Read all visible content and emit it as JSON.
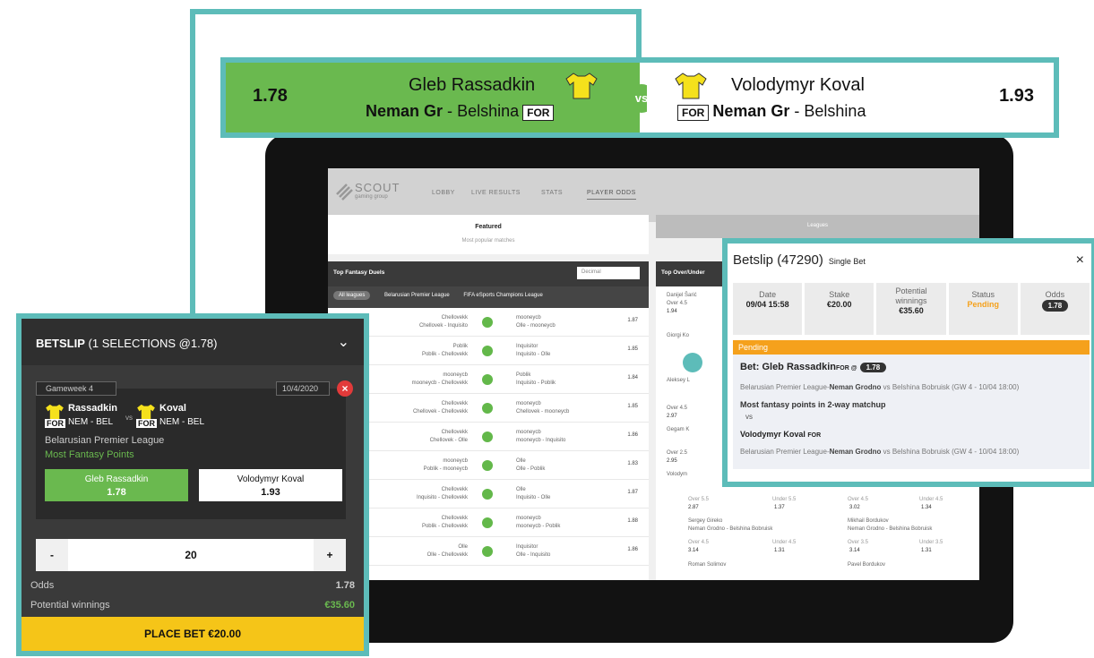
{
  "colors": {
    "accent_teal": "#5dbcb9",
    "green": "#6ab94f",
    "yellow": "#f5c518",
    "pending": "#f5a11c"
  },
  "duel": {
    "left_odds": "1.78",
    "left_player": "Gleb Rassadkin",
    "left_team": "Neman Gr",
    "left_sep": "-",
    "left_opp": "Belshina",
    "left_pos": "FOR",
    "vs": "vs",
    "right_player": "Volodymyr Koval",
    "right_team": "Neman Gr",
    "right_sep": "-",
    "right_opp": "Belshina",
    "right_pos": "FOR",
    "right_odds": "1.93"
  },
  "screen": {
    "logo": "SCOUT",
    "logo_sub": "gaming group",
    "nav": [
      "LOBBY",
      "LIVE RESULTS",
      "STATS",
      "PLAYER ODDS"
    ],
    "tab_featured": "Featured",
    "tab_featured_sub": "Most popular matches",
    "tab_leagues": "Leagues",
    "duels_title": "Top Fantasy Duels",
    "duels_select": "Decimal",
    "leagues": [
      "All leagues",
      "Belarusian Premier League",
      "FIFA eSports Champions League"
    ],
    "ou_title": "Top Over/Under",
    "rows": [
      {
        "l1": "Chellovekk",
        "l2": "Chellovek - Inquisito",
        "r1": "mooneycb",
        "r2": "Olle - mooneycb",
        "odds": "1.87"
      },
      {
        "l1": "Poblik",
        "l2": "Poblik - Chellovekk",
        "r1": "Inquisitor",
        "r2": "Inquisito - Olle",
        "odds": "1.85"
      },
      {
        "l1": "mooneycb",
        "l2": "mooneycb - Chellovekk",
        "r1": "Poblik",
        "r2": "Inquisito - Poblik",
        "odds": "1.84"
      },
      {
        "l1": "Chellovekk",
        "l2": "Chellovek - Chellovekk",
        "r1": "mooneycb",
        "r2": "Chellovek - mooneycb",
        "odds": "1.85"
      },
      {
        "l1": "Chellovekk",
        "l2": "Chellovek - Olle",
        "r1": "mooneycb",
        "r2": "mooneycb - Inquisito",
        "odds": "1.86"
      },
      {
        "l1": "mooneycb",
        "l2": "Poblik - mooneycb",
        "r1": "Olle",
        "r2": "Olle - Poblik",
        "odds": "1.83"
      },
      {
        "l1": "Chellovekk",
        "l2": "Inquisito - Chellovekk",
        "r1": "Olle",
        "r2": "Inquisito - Olle",
        "odds": "1.87"
      },
      {
        "l1": "Chellovekk",
        "l2": "Poblik - Chellovekk",
        "r1": "mooneycb",
        "r2": "mooneycb - Poblik",
        "odds": "1.88"
      },
      {
        "l1": "Olle",
        "l2": "Olle - Chellovekk",
        "r1": "Inquisitor",
        "r2": "Olle - Inquisito",
        "odds": "1.86"
      }
    ],
    "ou_rows": [
      {
        "name": "Danijel Šarić",
        "odds": "1.94",
        "label": "Over 4.5"
      },
      {
        "name": "Giorgi Ko",
        "odds": "",
        "label": ""
      },
      {
        "name": "Aleksey L",
        "odds": "",
        "label": ""
      },
      {
        "name": "Gegam K",
        "odds": "2.97",
        "label": "Over 4.5"
      },
      {
        "name": "Volodym",
        "odds": "2.95",
        "label": "Over 2.5"
      }
    ],
    "ou_pairs": [
      {
        "over_label": "Over 5.5",
        "over": "2.87",
        "under_label": "Under 5.5",
        "under": "1.37",
        "over2_label": "Over 4.5",
        "over2": "3.02",
        "under2_label": "Under 4.5",
        "under2": "1.34"
      },
      {
        "p1": "Sergey Gireko",
        "p1_team": "Neman Grodno - Belshina Bobruisk",
        "p2": "Mikhail Bordukov",
        "p2_team": "Neman Grodno - Belshina Bobruisk"
      },
      {
        "over_label": "Over 4.5",
        "over": "3.14",
        "under_label": "Under 4.5",
        "under": "1.31",
        "over2_label": "Over 3.5",
        "over2": "3.14",
        "under2_label": "Under 3.5",
        "under2": "1.31"
      },
      {
        "p1": "Roman Solimov",
        "p2": "Pavel Bordukov"
      }
    ]
  },
  "betslip_left": {
    "title_bold": "BETSLIP",
    "title_rest": "(1 SELECTIONS @1.78)",
    "gameweek": "Gameweek 4",
    "date": "10/4/2020",
    "p1_name": "Rassadkin",
    "p1_pos": "FOR",
    "p1_match": "NEM - BEL",
    "vs": "vs",
    "p2_name": "Koval",
    "p2_pos": "FOR",
    "p2_match": "NEM - BEL",
    "league": "Belarusian Premier League",
    "market": "Most Fantasy Points",
    "pick1": "Gleb Rassadkin",
    "pick1_odds": "1.78",
    "pick2": "Volodymyr Koval",
    "pick2_odds": "1.93",
    "minus": "-",
    "stake": "20",
    "plus": "+",
    "odds_label": "Odds",
    "odds_value": "1.78",
    "win_label": "Potential winnings",
    "win_value": "€35.60",
    "place_bet": "PLACE BET  €20.00"
  },
  "betslip_right": {
    "title": "Betslip (47290)",
    "subtitle": "Single Bet",
    "close": "×",
    "date_label": "Date",
    "date_value": "09/04 15:58",
    "stake_label": "Stake",
    "stake_value": "€20.00",
    "winnings_label": "Potential winnings",
    "winnings_value": "€35.60",
    "status_label": "Status",
    "status_value": "Pending",
    "odds_label": "Odds",
    "odds_value": "1.78",
    "pending_bar": "Pending",
    "bet_prefix": "Bet:",
    "bet_player": "Gleb Rassadkin",
    "bet_pos": "FOR @",
    "bet_odds": "1.78",
    "match1_league": "Belarusian Premier League-",
    "match1_home": "Neman Grodno",
    "match1_rest": " vs Belshina Bobruisk (GW 4 - 10/04 18:00)",
    "market": "Most fantasy points in 2-way matchup",
    "vs": "vs",
    "opponent": "Volodymyr Koval",
    "opponent_pos": "FOR",
    "match2_league": "Belarusian Premier League-",
    "match2_home": "Neman Grodno",
    "match2_rest": " vs Belshina Bobruisk (GW 4 - 10/04 18:00)"
  }
}
